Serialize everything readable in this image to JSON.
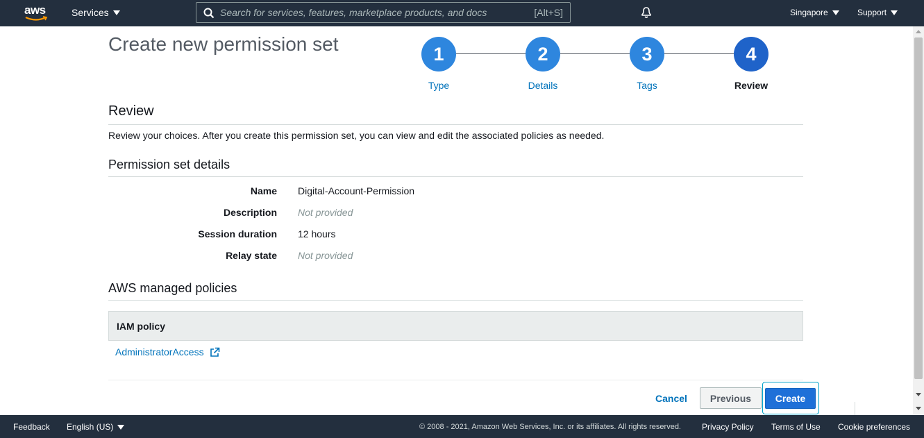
{
  "topnav": {
    "logo_text": "aws",
    "services_label": "Services",
    "search_placeholder": "Search for services, features, marketplace products, and docs",
    "search_shortcut": "[Alt+S]",
    "region_label": "Singapore",
    "support_label": "Support"
  },
  "page": {
    "title": "Create new permission set"
  },
  "steps": [
    {
      "number": "1",
      "label": "Type"
    },
    {
      "number": "2",
      "label": "Details"
    },
    {
      "number": "3",
      "label": "Tags"
    },
    {
      "number": "4",
      "label": "Review"
    }
  ],
  "review": {
    "heading": "Review",
    "description": "Review your choices. After you create this permission set, you can view and edit the associated policies as needed."
  },
  "details": {
    "heading": "Permission set details",
    "rows": [
      {
        "label": "Name",
        "value": "Digital-Account-Permission"
      },
      {
        "label": "Description",
        "value": "Not provided"
      },
      {
        "label": "Session duration",
        "value": "12 hours"
      },
      {
        "label": "Relay state",
        "value": "Not provided"
      }
    ]
  },
  "policies": {
    "heading": "AWS managed policies",
    "column_header": "IAM policy",
    "items": [
      "AdministratorAccess"
    ]
  },
  "actions": {
    "cancel": "Cancel",
    "previous": "Previous",
    "create": "Create"
  },
  "footer": {
    "feedback": "Feedback",
    "language": "English (US)",
    "copyright": "© 2008 - 2021, Amazon Web Services, Inc. or its affiliates. All rights reserved.",
    "privacy": "Privacy Policy",
    "terms": "Terms of Use",
    "cookies": "Cookie preferences"
  },
  "colors": {
    "nav_bg": "#232f3e",
    "step_blue": "#2e86de",
    "step_active": "#1f63c9",
    "link_blue": "#0073bb",
    "primary_button": "#1f70d8"
  }
}
